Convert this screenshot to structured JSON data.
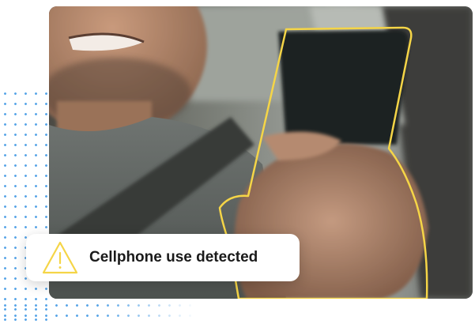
{
  "alert": {
    "message": "Cellphone use detected",
    "icon": "warning-triangle-icon",
    "icon_color": "#f5d547"
  },
  "colors": {
    "highlight_outline": "#f5d547",
    "dot_pattern": "#5aa6e8"
  }
}
